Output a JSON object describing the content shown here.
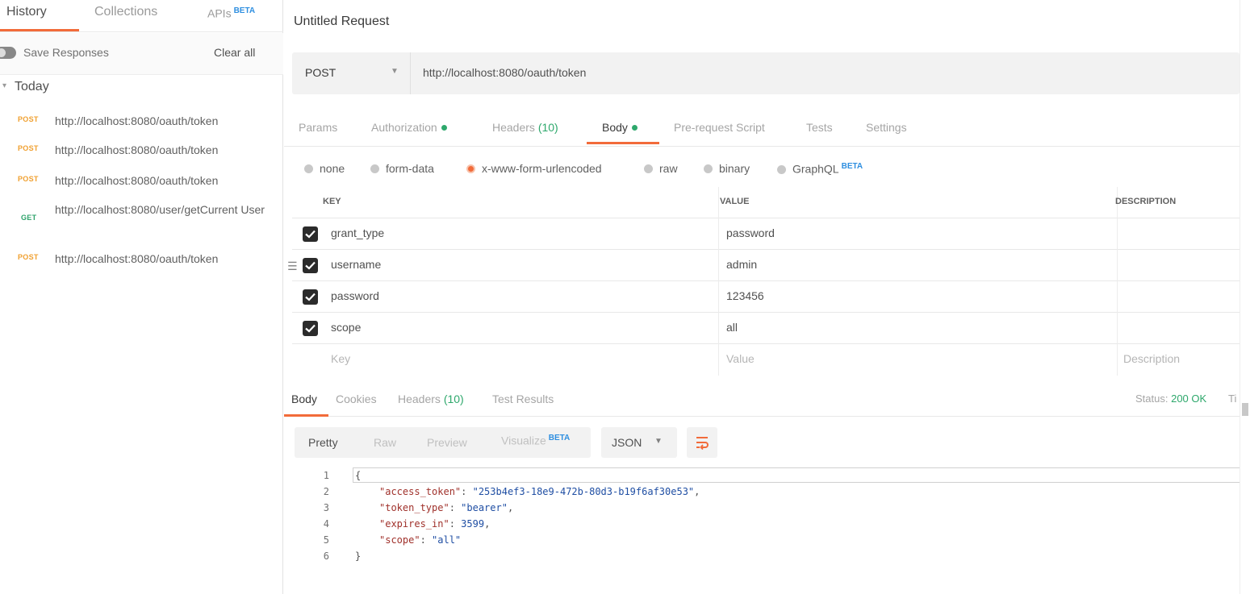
{
  "sidebar": {
    "tabs": [
      {
        "label": "History",
        "active": true
      },
      {
        "label": "Collections",
        "active": false
      },
      {
        "label": "APIs",
        "badge": "BETA",
        "active": false
      }
    ],
    "save_responses_label": "Save Responses",
    "save_responses_enabled": false,
    "clear_all_label": "Clear all",
    "group_label": "Today",
    "history": [
      {
        "method": "POST",
        "url": "http://localhost:8080/oauth/token"
      },
      {
        "method": "POST",
        "url": "http://localhost:8080/oauth/token"
      },
      {
        "method": "POST",
        "url": "http://localhost:8080/oauth/token"
      },
      {
        "method": "GET",
        "url": "http://localhost:8080/user/getCurrent User"
      },
      {
        "method": "POST",
        "url": "http://localhost:8080/oauth/token"
      }
    ]
  },
  "request": {
    "title": "Untitled Request",
    "method": "POST",
    "url": "http://localhost:8080/oauth/token",
    "tabs": [
      {
        "label": "Params"
      },
      {
        "label": "Authorization",
        "dot": true
      },
      {
        "label": "Headers",
        "count": "(10)"
      },
      {
        "label": "Body",
        "dot": true,
        "active": true
      },
      {
        "label": "Pre-request Script"
      },
      {
        "label": "Tests"
      },
      {
        "label": "Settings"
      }
    ],
    "body_types": [
      {
        "label": "none"
      },
      {
        "label": "form-data"
      },
      {
        "label": "x-www-form-urlencoded",
        "selected": true
      },
      {
        "label": "raw"
      },
      {
        "label": "binary"
      },
      {
        "label": "GraphQL",
        "badge": "BETA"
      }
    ],
    "table": {
      "headers": [
        "KEY",
        "VALUE",
        "DESCRIPTION"
      ],
      "rows": [
        {
          "key": "grant_type",
          "value": "password",
          "checked": true
        },
        {
          "key": "username",
          "value": "admin",
          "checked": true
        },
        {
          "key": "password",
          "value": "123456",
          "checked": true
        },
        {
          "key": "scope",
          "value": "all",
          "checked": true
        }
      ],
      "placeholders": {
        "key": "Key",
        "value": "Value",
        "description": "Description"
      }
    }
  },
  "response": {
    "tabs": [
      {
        "label": "Body",
        "active": true
      },
      {
        "label": "Cookies"
      },
      {
        "label": "Headers",
        "count": "(10)"
      },
      {
        "label": "Test Results"
      }
    ],
    "status_label": "Status:",
    "status_value": "200 OK",
    "time_label_partial": "Ti",
    "formats": [
      {
        "label": "Pretty",
        "active": true
      },
      {
        "label": "Raw"
      },
      {
        "label": "Preview"
      },
      {
        "label": "Visualize",
        "badge": "BETA"
      }
    ],
    "format_select": "JSON",
    "code_lines": [
      {
        "n": "1",
        "text": "{"
      },
      {
        "n": "2",
        "key": "\"access_token\"",
        "value": "\"253b4ef3-18e9-472b-80d3-b19f6af30e53\"",
        "trail": ","
      },
      {
        "n": "3",
        "key": "\"token_type\"",
        "value": "\"bearer\"",
        "trail": ","
      },
      {
        "n": "4",
        "key": "\"expires_in\"",
        "value": "3599",
        "trail": ","
      },
      {
        "n": "5",
        "key": "\"scope\"",
        "value": "\"all\"",
        "trail": ""
      },
      {
        "n": "6",
        "text": "}"
      }
    ]
  },
  "colors": {
    "accent": "#f26b3a",
    "success": "#2ea86c",
    "post": "#f0a030",
    "get": "#2fa36b",
    "beta": "#2f8fe0"
  }
}
